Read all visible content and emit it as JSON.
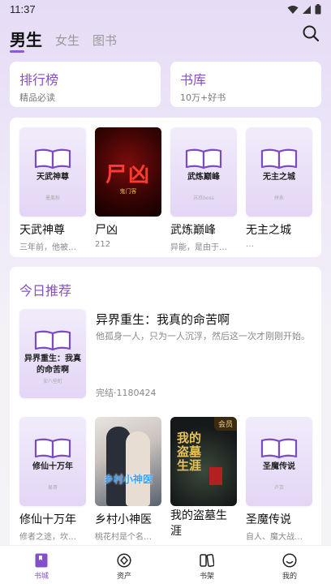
{
  "status": {
    "time": "11:37"
  },
  "tabs": {
    "active": "男生",
    "items": [
      "女生",
      "图书"
    ]
  },
  "quick_links": [
    {
      "title": "排行榜",
      "subtitle": "精品必读"
    },
    {
      "title": "书库",
      "subtitle": "10万+好书"
    }
  ],
  "featured_books": [
    {
      "name": "天武神尊",
      "desc": "三年前，他被…",
      "cover_title": "天武神尊",
      "cover_author": "墨离秋"
    },
    {
      "name": "尸凶",
      "desc": "212",
      "cover_title": "尸凶",
      "cover_author": "鬼门客"
    },
    {
      "name": "武炼巅峰",
      "desc": "异能，是由于…",
      "cover_title": "武炼巅峰",
      "cover_author": "苏玖boss"
    },
    {
      "name": "无主之城",
      "desc": "…",
      "cover_title": "无主之城",
      "cover_author": "拼永"
    }
  ],
  "today_recommend": {
    "section_title": "今日推荐",
    "name": "异界重生：我真的命苦啊",
    "desc": "他孤身一人，只为一人沉浮，然后这一次才刚刚开始。",
    "meta": "完结·1180424",
    "cover_title": "异界重生：我真的命苦啊",
    "cover_author": "安八些町"
  },
  "more_books": [
    {
      "name": "修仙十万年",
      "desc": "修者之途，坎…",
      "cover_title": "修仙十万年",
      "cover_author": "易哥"
    },
    {
      "name": "乡村小神医",
      "desc": "桃花村是个名…",
      "cover_title": "乡村小神医"
    },
    {
      "name": "我的盗墓生涯",
      "desc": "",
      "cover_title": "我的盗墓生涯",
      "badge": "会员"
    },
    {
      "name": "圣魔传说",
      "desc": "自人、魔大战…",
      "cover_title": "圣魔传说",
      "cover_author": "卢京"
    }
  ],
  "bottom_nav": [
    {
      "label": "书城",
      "icon": "bookstore-icon",
      "active": true
    },
    {
      "label": "资产",
      "icon": "assets-icon",
      "active": false
    },
    {
      "label": "书架",
      "icon": "bookshelf-icon",
      "active": false
    },
    {
      "label": "我的",
      "icon": "profile-icon",
      "active": false
    }
  ],
  "colors": {
    "accent": "#8450c9",
    "background_top": "#e6dcf6"
  }
}
